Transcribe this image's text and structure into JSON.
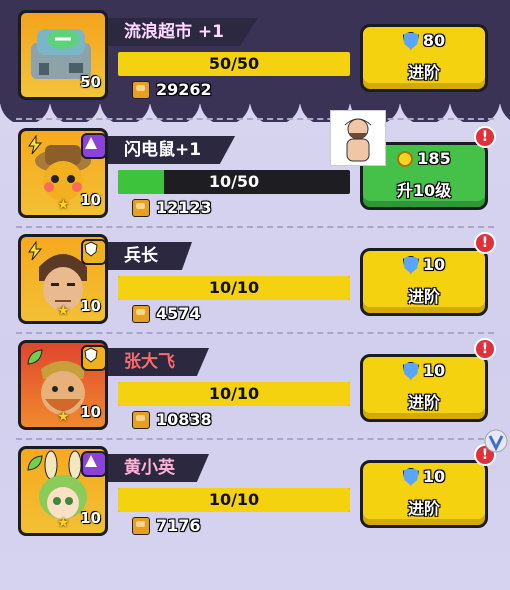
{
  "heroes": [
    {
      "name": "流浪超市 +1",
      "level": "50",
      "progress_text": "50/50",
      "progress_fraction": 1.0,
      "power": "29262",
      "button": {
        "cost": "80",
        "label": "进阶",
        "cost_icon": "shield-icon",
        "style": "yellow"
      },
      "has_alert": false
    },
    {
      "name": "闪电鼠+1",
      "level": "10",
      "progress_text": "10/50",
      "progress_fraction": 0.2,
      "power": "12123",
      "button": {
        "cost": "185",
        "label": "升10级",
        "cost_icon": "coin-icon",
        "style": "green"
      },
      "has_alert": true
    },
    {
      "name": "兵长",
      "level": "10",
      "progress_text": "10/10",
      "progress_fraction": 1.0,
      "power": "4574",
      "button": {
        "cost": "10",
        "label": "进阶",
        "cost_icon": "shield-icon",
        "style": "yellow"
      },
      "has_alert": true
    },
    {
      "name": "张大飞",
      "level": "10",
      "progress_text": "10/10",
      "progress_fraction": 1.0,
      "power": "10838",
      "button": {
        "cost": "10",
        "label": "进阶",
        "cost_icon": "shield-icon",
        "style": "yellow"
      },
      "has_alert": true
    },
    {
      "name": "黄小英",
      "level": "10",
      "progress_text": "10/10",
      "progress_fraction": 1.0,
      "power": "7176",
      "button": {
        "cost": "10",
        "label": "进阶",
        "cost_icon": "shield-icon",
        "style": "yellow"
      },
      "has_alert": true
    }
  ],
  "colors": {
    "bar_yellow": "#f5d20f",
    "bar_green": "#3ec43c",
    "button_yellow": "#f5d20f",
    "button_green": "#45c14a",
    "alert_red": "#e0313a",
    "name_tag_bg": "#2b2840"
  },
  "alert_glyph": "!"
}
